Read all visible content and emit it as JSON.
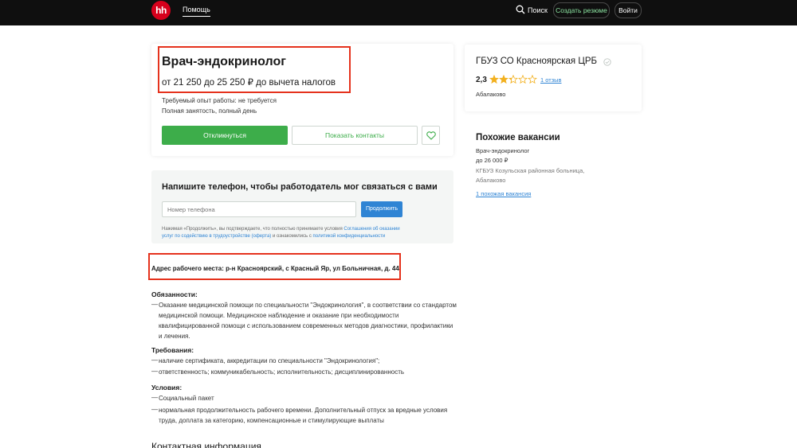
{
  "header": {
    "logo_text": "hh",
    "help": "Помощь",
    "search": "Поиск",
    "create_resume": "Создать резюме",
    "login": "Войти"
  },
  "vacancy": {
    "title": "Врач-эндокринолог",
    "salary": "от 21 250 до 25 250 ₽ до вычета налогов",
    "experience": "Требуемый опыт работы: не требуется",
    "employment": "Полная занятость, полный день",
    "apply_label": "Откликнуться",
    "contacts_label": "Показать контакты"
  },
  "phone_form": {
    "title": "Напишите телефон, чтобы работодатель мог связаться с вами",
    "placeholder": "Номер телефона",
    "continue_label": "Продолжить",
    "legal_prefix": "Нажимая «Продолжить», вы подтверждаете, что полностью принимаете условия ",
    "legal_link1": "Соглашения об оказании услуг по содействию в трудоустройстве (оферта)",
    "legal_mid": " и ознакомились с ",
    "legal_link2": "политикой конфиденциальности"
  },
  "address": "Адрес рабочего места: р-н Красноярский, с Красный Яр, ул Больничная, д. 44",
  "description": {
    "duties_head": "Обязанности:",
    "duties": [
      "Оказание медицинской помощи по специальности \"Эндокринология\", в соответствии со стандартом",
      "медицинской помощи. Медицинское наблюдение и оказание при необходимости",
      "квалифицированной помощи с использованием современных методов диагностики, профилактики",
      "и лечения."
    ],
    "req_head": "Требования:",
    "req1": "наличие сертификата, аккредитации по специальности \"Эндокринология\";",
    "req2": "ответственность; коммуникабельность; исполнительность; дисциплинированность",
    "cond_head": "Условия:",
    "cond1": "Социальный пакет",
    "cond2_l1": "нормальная продолжительность рабочего времени. Дополнительный отпуск за вредные условия",
    "cond2_l2": "труда, доплата за категорию, компенсационные и стимулирующие выплаты",
    "contact_head": "Контактная информация",
    "dash": "—"
  },
  "employer": {
    "name": "ГБУЗ СО Красноярская ЦРБ",
    "rating": "2,3",
    "rating_value": 2.3,
    "reviews": "1 отзыв",
    "city": "Абалаково"
  },
  "similar": {
    "head": "Похожие вакансии",
    "title": "Врач-эндокринолог",
    "salary": "до 26 000 ₽",
    "org_l1": "КГБУЗ Козульская районная больница,",
    "org_l2": "Абалаково",
    "more": "1 похожая вакансия"
  },
  "colors": {
    "accent_green": "#3dad4a",
    "link_blue": "#2f84d4",
    "brand_red": "#d6001c",
    "highlight_red": "#e5321d",
    "star_gold": "#f2b01e"
  }
}
